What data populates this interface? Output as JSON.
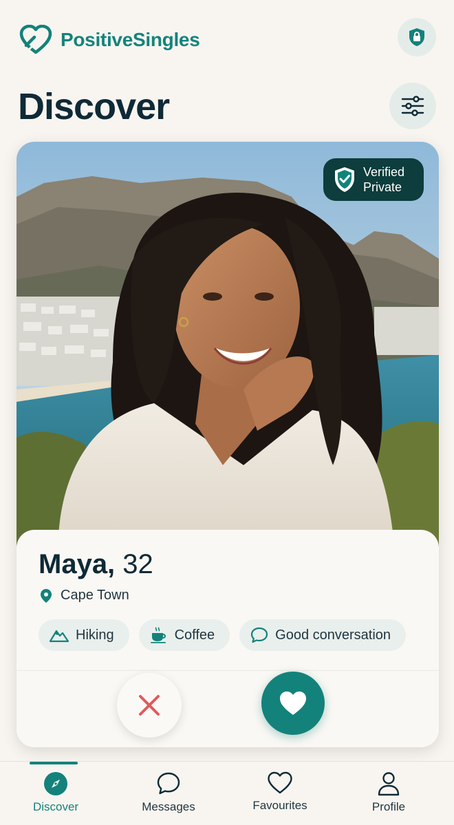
{
  "header": {
    "app_name": "PositiveSingles",
    "page_title": "Discover"
  },
  "profile": {
    "name": "Maya,",
    "age": "32",
    "location": "Cape Town",
    "verified_line1": "Verified",
    "verified_line2": "Private",
    "interests": [
      {
        "label": "Hiking",
        "icon": "mountain-icon"
      },
      {
        "label": "Coffee",
        "icon": "coffee-icon"
      },
      {
        "label": "Good conversation",
        "icon": "chat-bubble-icon"
      }
    ]
  },
  "nav": {
    "items": [
      {
        "label": "Discover",
        "icon": "compass-icon",
        "active": true
      },
      {
        "label": "Messages",
        "icon": "message-icon",
        "active": false
      },
      {
        "label": "Favourites",
        "icon": "heart-outline-icon",
        "active": false
      },
      {
        "label": "Profile",
        "icon": "user-icon",
        "active": false
      }
    ]
  },
  "colors": {
    "accent": "#13827b",
    "background": "#f8f5f0",
    "dark_text": "#0f2a36",
    "badge_bg": "#0d3d3c",
    "reject": "#e05a5a"
  }
}
